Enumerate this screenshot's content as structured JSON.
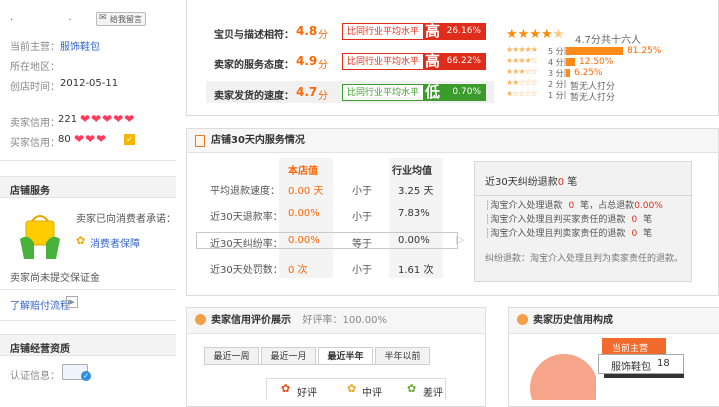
{
  "sidebar": {
    "seller_name": "　　　　",
    "message_link": "给我留言",
    "main_business_label": "当前主营：",
    "main_business_value": "服饰鞋包",
    "location_label": "所在地区：",
    "founded_label": "创店时间：",
    "founded_value": "2012-05-11",
    "seller_credit_label": "卖家信用：",
    "seller_credit_value": "221",
    "seller_hearts": 5,
    "buyer_credit_label": "买家信用：",
    "buyer_credit_value": "80",
    "buyer_hearts": 3,
    "shop_service_title": "店铺服务",
    "promise_text": "卖家已向消费者承诺：",
    "consumer_protection": "消费者保障",
    "deposit_note": "卖家尚未提交保证金",
    "payment_process_link": "了解赔付流程",
    "business_qual_title": "店铺经营资质",
    "cert_label": "认证信息："
  },
  "dsr": {
    "rows": [
      {
        "label": "宝贝与描述相符：",
        "score": "4.8",
        "unit": "分",
        "compare": "比同行业平均水平",
        "level": "高",
        "pct": "26.16%",
        "status": "high"
      },
      {
        "label": "卖家的服务态度：",
        "score": "4.9",
        "unit": "分",
        "compare": "比同行业平均水平",
        "level": "高",
        "pct": "66.22%",
        "status": "high"
      },
      {
        "label": "卖家发货的速度：",
        "score": "4.7",
        "unit": "分",
        "compare": "比同行业平均水平",
        "level": "低",
        "pct": "0.70%",
        "status": "low"
      }
    ],
    "colors": {
      "high": "#e02d1b",
      "low": "#3b9c2b"
    }
  },
  "rating_summary": {
    "average": "4.7分",
    "count_text": "共十六人",
    "average_stars": 4.5,
    "breakdown": [
      {
        "label": "5 分",
        "percent": "81.25%",
        "fraction": 0.8125
      },
      {
        "label": "4 分",
        "percent": "12.50%",
        "fraction": 0.125
      },
      {
        "label": "3 分",
        "percent": "6.25%",
        "fraction": 0.0625
      },
      {
        "label": "2 分",
        "percent": "暂无人打分",
        "fraction": 0
      },
      {
        "label": "1 分",
        "percent": "暂无人打分",
        "fraction": 0
      }
    ]
  },
  "service30": {
    "title": "店铺30天内服务情况",
    "col_shop": "本店值",
    "col_industry": "行业均值",
    "rows": [
      {
        "label": "平均退款速度：",
        "shop": "0.00 天",
        "cmp": "小于",
        "industry": "3.25 天"
      },
      {
        "label": "近30天退款率：",
        "shop": "0.00%",
        "cmp": "小于",
        "industry": "7.83%"
      },
      {
        "label": "近30天纠纷率：",
        "shop": "0.00%",
        "cmp": "等于",
        "industry": "0.00%"
      },
      {
        "label": "近30天处罚数：",
        "shop": "0 次",
        "cmp": "小于",
        "industry": "1.61 次"
      }
    ],
    "dispute": {
      "title_prefix": "近30天纠纷退款",
      "title_value": "0",
      "title_suffix": "笔",
      "lines": [
        {
          "prefix": "淘宝介入处理退款",
          "value": "0",
          "suffix": "笔，占总退款",
          "value2": "0.00%"
        },
        {
          "prefix": "淘宝介入处理且判买家责任的退款",
          "value": "0",
          "suffix": "笔",
          "value2": ""
        },
        {
          "prefix": "淘宝介入处理且判卖家责任的退款",
          "value": "0",
          "suffix": "笔",
          "value2": ""
        }
      ],
      "footnote": "纠纷退款：淘宝介入处理且判为卖家责任的退款。"
    }
  },
  "seller_reviews": {
    "title": "卖家信用评价展示",
    "good_rate": "好评率：100.00%",
    "tabs": [
      "最近一周",
      "最近一月",
      "最近半年",
      "半年以前"
    ],
    "active_tab": 2,
    "kinds": [
      "好评",
      "中评",
      "差评"
    ]
  },
  "credit_history": {
    "title": "卖家历史信用构成",
    "current_label": "当前主营",
    "category": "服饰鞋包",
    "count": "18"
  }
}
